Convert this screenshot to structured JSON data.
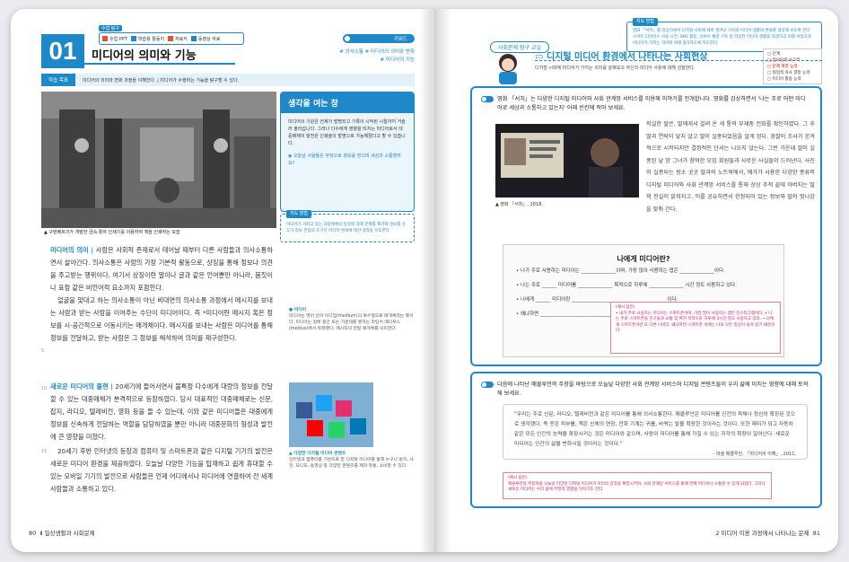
{
  "left": {
    "tags": {
      "header": "수업 탐구",
      "items": [
        {
          "label": "수업 PPT",
          "color": "#e8542d",
          "icon": "ppt-icon"
        },
        {
          "label": "학습용 활동지",
          "color": "#1e88c8",
          "icon": "worksheet-icon"
        },
        {
          "label": "자료지",
          "color": "#e8542d",
          "icon": "pdf-icon"
        },
        {
          "label": "동영상 자료",
          "color": "#1e88c8",
          "icon": "video-icon"
        }
      ]
    },
    "keyword_label": "키워드",
    "section_number": "01",
    "section_title": "미디어의 의미와 기능",
    "keywords_line1": "# 의사소통  # 미디어의 의미와 변화",
    "keywords_line2": "# 미디어의 기능",
    "goal_label": "학습 목표",
    "goal_text": "미디어의 의미와 변화 과정을 이해한다.  |  미디어가 수행하는 기능을 탐구할 수 있다.",
    "photo_caption": "▲ 구텐베르크가 개발한 금속 활자 인쇄기를 이용하여 책을 인쇄하는 모습",
    "think_title": "생각을 여는 창",
    "think_body": "미디어의 기원은 언제가 발명되고 기록이 시작된 시절까지 거슬러 올라갑니다. 그러나 다수에게 영향을 미치는 미디어로서 대중매체의 발전은 인쇄술의 발명으로 가능해졌다고 할 수 있습니다.",
    "think_question": "오늘날 사람들은 무엇으로 정보를 얻으며 세상과 소통할까요?",
    "guide_label": "지도 방법",
    "guide_text": "미디어가 가지고 있는 대중매체의 등장에 대해 문제를 제기해 정보를 유도가 정보 전달의 도구인 미디어 변화에 대한 생각을 유도한다.",
    "para1_head": "미디어의 의미 |",
    "para1": "사람은 사회적 존재로서 태어날 때부터 다른 사람들과 의사소통하면서 살아간다. 의사소통은 사람의 가장 기본적 활동으로, 상징을 통해 정보나 의견을 주고받는 행위이다. 여기서 상징이란 말이나 글과 같은 언어뿐만 아니라, 몸짓이나 표정 같은 비언어적 요소까지 포함한다.",
    "para2": "얼굴을 맞대고 하는 의사소통이 아닌 비대면의 의사소통 과정에서 메시지를 보내는 사람과 받는 사람을 이어주는 수단이 미디어이다. 즉 *미디어란 메시지 혹은 정보를 시·공간적으로 이동시키는 매개체이다. 메시지를 보내는 사람은 미디어를 통해 정보를 전달하고, 받는 사람은 그 정보를 해석하여 의미를 재구성한다.",
    "side_term": "미디어",
    "side_note": "미디어는 영어 단어 미디엄(medium)의 복수형으로 매개체라는 뜻이다. 미디어는 원래 중간 또는 가운데를 뜻하는 라틴어 메디우스(medius)에서 유래했다. 메시지의 전달 매개체를 의미한다.",
    "para3_head": "새로운 미디어의 출현 |",
    "para3": "20세기에 들어서면서 불특정 다수에게 대량의 정보를 전달할 수 있는 대중매체가 본격적으로 등장하였다. 당시 대표적인 대중매체로는 신문, 잡지, 라디오, 텔레비전, 영화 등을 들 수 있는데, 이와 같은 미디어들은 대중에게 정보를 신속하게 전달하는 역할을 담당하였을 뿐만 아니라 대중문화의 형성과 발전에 큰 영향을 미쳤다.",
    "para4": "20세기 후반 인터넷의 등장과 컴퓨터 및 스마트폰과 같은 디지털 기기의 발전은 새로운 미디어 환경을 제공하였다. 오늘날 다양한 기능을 탑재하고 쉽게 휴대할 수 있는 모바일 기기의 발전으로 사람들은 언제 어디에서나 미디어에 연결하여 전 세계 사람들과 소통하고 있다.",
    "sns_caption": "▲ 다양한 디지털 미디어 콘텐츠",
    "sns_note": "인터넷과 컴퓨터를 기반으로 한 디지털 미디어를 통해 누구나 문자, 사진, 오디오, 동영상 등 다양한 콘텐츠를 제작·유통, 소비할 수 있다.",
    "line_numbers": [
      "5",
      "10",
      "15"
    ],
    "page_num": "80",
    "footer": "Ⅱ 일상생활과 사회문제"
  },
  "right": {
    "label": "사회문제 탐구 교실",
    "title": "디지털 미디어 환경에서 나타나는 사회현상",
    "subtitle": "디지털 시대에 미디어가 가지는 의미를 살펴보고 자신의 미디어 사용에 대해 성찰한다.",
    "guide_label": "지도 방법",
    "guide_text": "영화 「서치」를 감상하면서 디지털 사회에 새로 생겨난 가치와 미디어 생활의 변화를 생각해 보도록 한다. 스마트 디바이스 사용 시간, SNS 활동, 유튜브 채널 구독 등 다양한 미디어 생활을 점검하고 이를 바탕으로 미디어가 가지는 의미에 대해 생각하도록 지도한다.",
    "checklist": [
      {
        "text": "□ 단계",
        "red": false
      },
      {
        "text": "□ 정보탐색 사고력",
        "red": true
      },
      {
        "text": "□ 문제 해결 능력",
        "red": true
      },
      {
        "text": "□ 협업적 의사 결정 능력",
        "red": false
      },
      {
        "text": "□ 미디어 활용 능력",
        "red": false
      }
    ],
    "q1": "영화 「서치」는 다양한 디지털 미디어와 사회 관계망 서비스를 이용해 이야기를 전개합니다. 영화를 감상하면서 '나는 주로 어떤 미디어로 세상과 소통하고 있는지' 아래 빈칸에 적어 보세요.",
    "video_caption": "▲ 영화 「서치」, 2018.",
    "story": "착실한 딸은, 딸에게서 걸려 온 세 통의 부재중 전화를 확인하였다. 그 후 딸과 연락이 닿지 않고 딸이 실종되었음을 알게 된다. 경찰이 조사가 본격적으로 시작되지만 결정적인 단서는 나오지 않는다. 그런 가운데 딸이 실종된 날 밤 그녀가 참여한 모임 회원들과 사로운 사실들이 드러난다. 사진이 실종되는 장소 곳곳 딸과의 노트북에서, 메가가 사용한 다양한 종류의 디지털 미디어와 사회 관계망 서비스를 통해 상상 추적 끝에 아버지는 딸의 진실이 밝혀지고. 이를 공유하면서 한정되어 있는 정보와 딸의 엇나감을 맞춰 간다.",
    "form_title": "나에게 미디어란?",
    "form_lines": [
      "• 나가 주로 사용하는 미디어는 ______________이며, 가장 많이 사용하는 앱은 ______________이다.",
      "• 나는 주로 ______ 미디어를 ______________ 목적으로 하루에 ______________ 시간 정도 사용하고 있다.",
      "• 나에게 ______ 미디어란 ______________________________________ 이다.",
      "• 왜냐하면 ______________________________________________________"
    ],
    "answer1_label": "(예시 답안)",
    "answer1": "• 내가 주로 사용하는 미디어는 스마트폰이며, 가장 많이 사용하는 앱은 인스타그램이다. • 나는 주로 스마트폰을 친구들과 소통 및 여가 목적으로 하루에 3시간 정도 사용하고 있다. • 나에게 스마트폰이란 또 다른 나이다. 왜냐하면 스마트폰 속에는 나의 모든 일상이 담겨 있기 때문이다.",
    "q2": "다음에 나타난 매클루언의 주장을 바탕으로 오늘날 다양한 사회 관계망 서비스와 디지털 콘텐츠들이 우리 삶에 미치는 영향에 대해 토의해 보세요.",
    "quote": "\"우리는 주로 신문, 라디오, 텔레비전과 같은 미디어를 통해 의사소통한다. 매클루언은 미디어를 인간의 육체나 정신의 확장된 것으로 생각했다. 즉 옷은 피부를, 책은 신체의 연장, 전화 기계는 귀를, 바퀴는 발을 확장한 것이라는 것이다. 또한 재미가 되고 자동차 같은 모든 인간의 능력을 확장시키는 것은 미디어와 같으며, 사람이 미디어를 통해 가질 수 있는 지각의 확장이 일어난다. 새로운 미디어는 인간의 삶을 변화시킬 것이라는 것이다.\"",
    "quote_source": "- 마셜 매클루언, 「미디어의 이해」, 2011.",
    "answer2_label": "(예시 답안)",
    "answer2": "매클루언의 주장처럼 오늘날 다양한 디지털 미디어가 우리의 감각을 확장시키며, 사회 관계망 서비스를 통해 언제 어디서나 소통할 수 있게 되었다. 그러나 새로운 미디어는 우리 삶에 부정적 영향을 미치기도 한다.",
    "page_num": "81",
    "footer": "2 미디어 이용 과정에서 나타나는 문제"
  }
}
